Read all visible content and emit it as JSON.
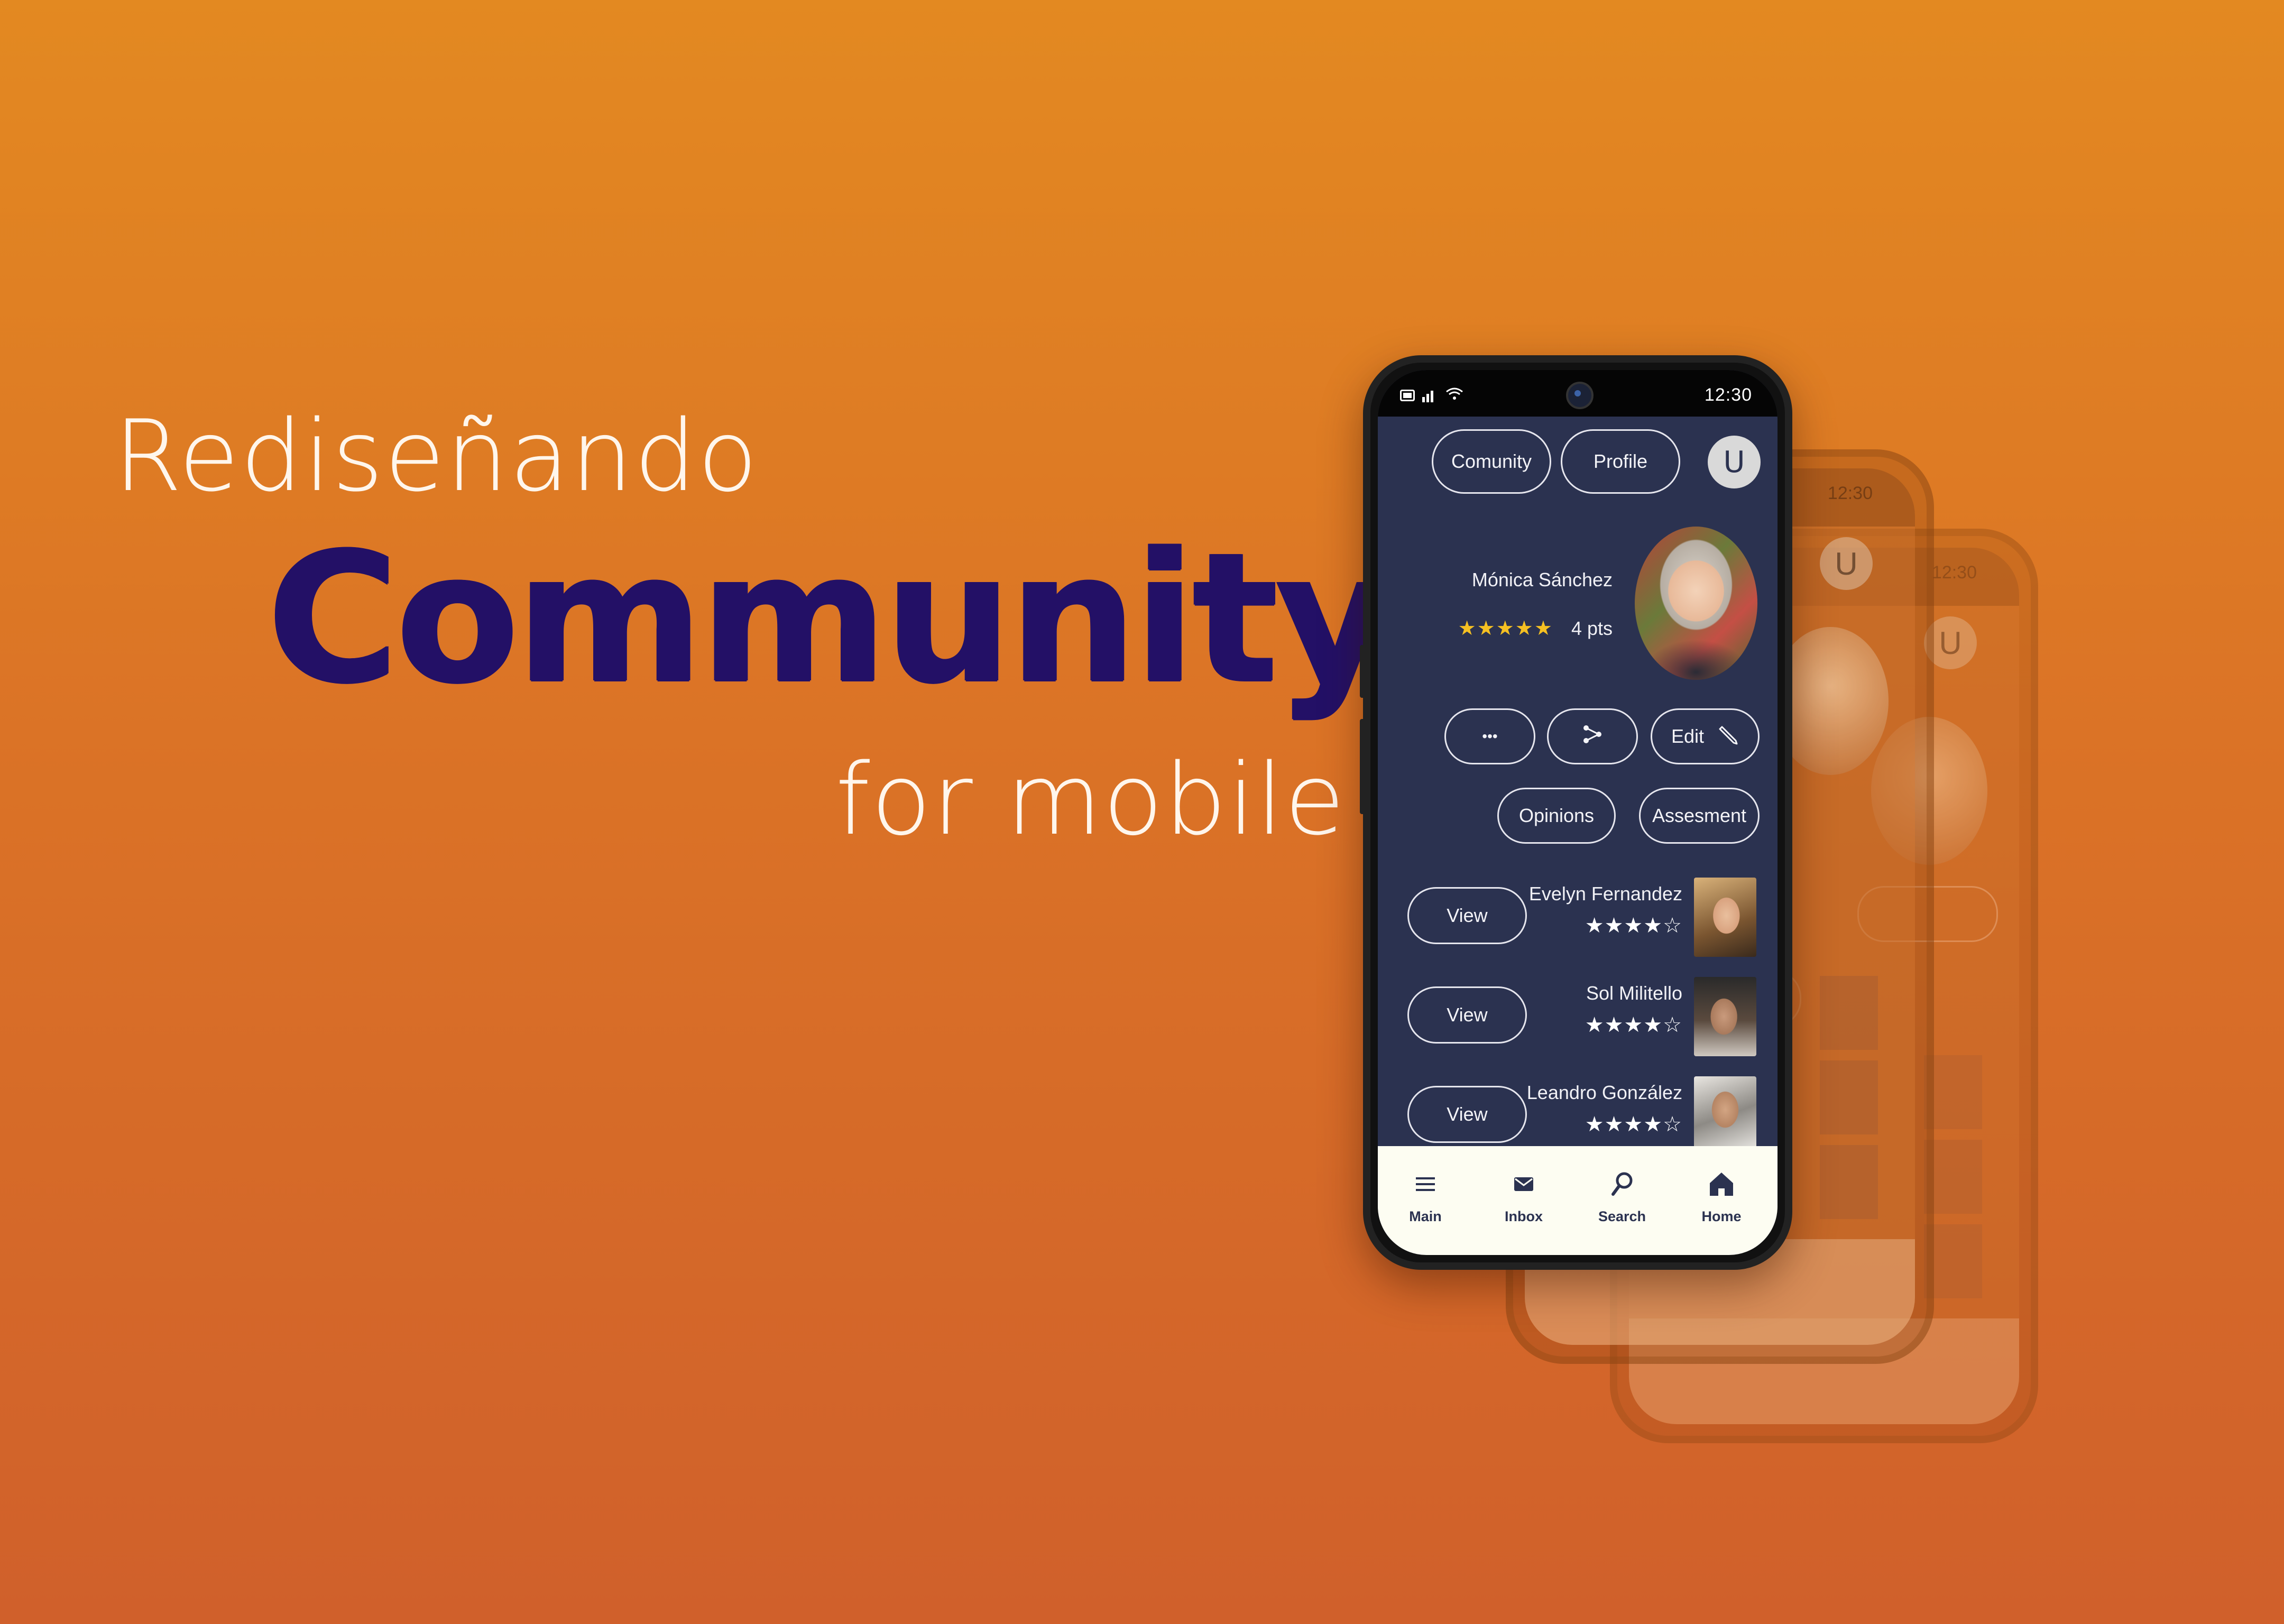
{
  "hero": {
    "line1": "Rediseñando",
    "title": "Community",
    "line3": "for mobile"
  },
  "status": {
    "time": "12:30"
  },
  "topbar": {
    "avatar_letter": "U",
    "profile_label": "Profile",
    "community_label": "Comunity"
  },
  "profile": {
    "name": "Mónica Sánchez",
    "points": "4 pts",
    "stars": "★★★★★"
  },
  "actions": {
    "edit_label": "Edit",
    "more_label": "•••"
  },
  "tabs": {
    "assessment": "Assesment",
    "opinions": "Opinions"
  },
  "contacts": [
    {
      "name": "Evelyn Fernandez",
      "stars": "★★★★☆",
      "view": "View"
    },
    {
      "name": "Sol Militello",
      "stars": "★★★★☆",
      "view": "View"
    },
    {
      "name": "Leandro González",
      "stars": "★★★★☆",
      "view": "View"
    }
  ],
  "nav": {
    "home": "Home",
    "search": "Search",
    "inbox": "Inbox",
    "main": "Main"
  },
  "colors": {
    "background_top": "#e38921",
    "background_bottom": "#d0602b",
    "title": "#231066",
    "screen": "#2b3250",
    "nav": "#fdfdf2",
    "star_gold": "#f5c022"
  }
}
